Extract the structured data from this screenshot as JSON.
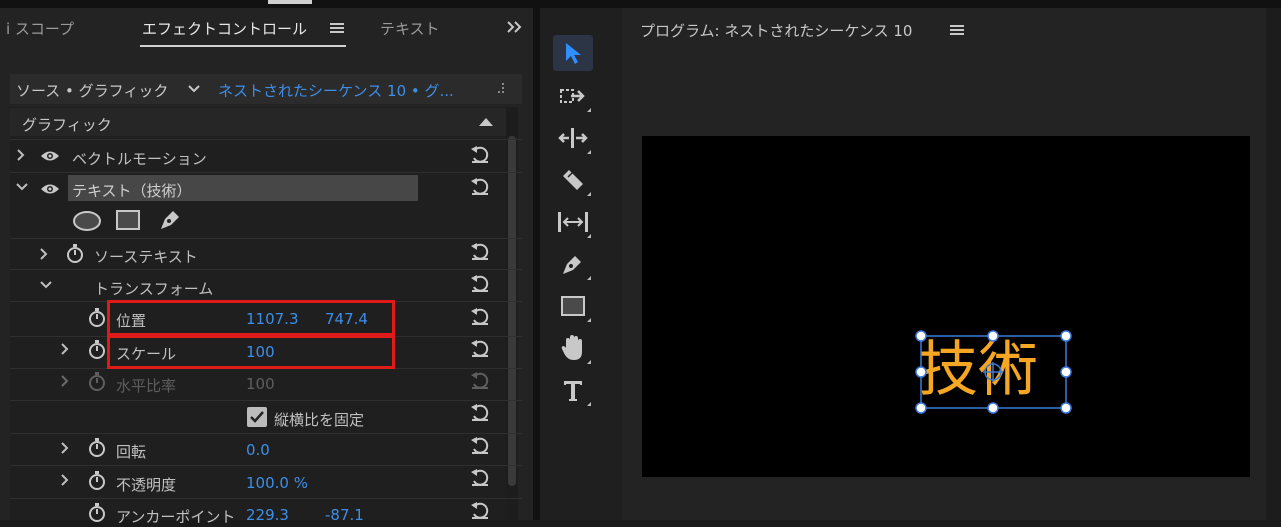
{
  "left_panel": {
    "tabs": [
      {
        "label": "i スコープ"
      },
      {
        "label": "エフェクトコントロール",
        "active": true
      },
      {
        "label": "テキスト"
      }
    ],
    "source_label": "ソース • グラフィック",
    "sequence_label": "ネストされたシーケンス 10 • グ...",
    "section_label": "グラフィック",
    "rows": [
      {
        "label": "ベクトルモーション"
      },
      {
        "label": "テキスト（技術）"
      },
      {
        "label": "ソーステキスト"
      },
      {
        "label": "トランスフォーム"
      },
      {
        "label": "位置",
        "value_x": "1107.3",
        "value_y": "747.4"
      },
      {
        "label": "スケール",
        "value": "100"
      },
      {
        "label": "水平比率",
        "value": "100"
      },
      {
        "label": "縦横比を固定"
      },
      {
        "label": "回転",
        "value": "0.0"
      },
      {
        "label": "不透明度",
        "value": "100.0 %"
      },
      {
        "label": "アンカーポイント",
        "value_x": "229.3",
        "value_y": "-87.1"
      }
    ]
  },
  "program": {
    "title": "プログラム: ネストされたシーケンス 10",
    "video_text": "技術",
    "text_color": "#f5a623",
    "selection_color": "#3a7ad9"
  },
  "tools": [
    "selection-tool-icon",
    "track-select-forward-icon",
    "ripple-edit-icon",
    "razor-icon",
    "slip-icon",
    "pen-icon",
    "rectangle-icon",
    "hand-icon",
    "type-icon"
  ],
  "colors": {
    "accent_blue": "#3e8ee8",
    "highlight_red": "#e01919",
    "tool_active_bg": "#2b3545",
    "tool_active_fg": "#2f8fff"
  }
}
